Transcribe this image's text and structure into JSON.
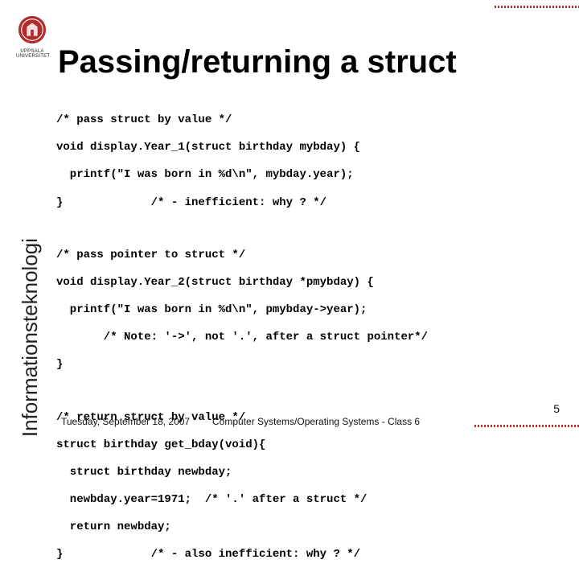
{
  "logo_text": "UPPSALA UNIVERSITET",
  "title": "Passing/returning a struct",
  "sidelabel": "Informationsteknologi",
  "code": {
    "block1": [
      "/* pass struct by value */",
      "void display.Year_1(struct birthday mybday) {",
      "  printf(\"I was born in %d\\n\", mybday.year);",
      "}             /* - inefficient: why ? */"
    ],
    "block2": [
      "/* pass pointer to struct */",
      "void display.Year_2(struct birthday *pmybday) {",
      "  printf(\"I was born in %d\\n\", pmybday->year);",
      "       /* Note: '->', not '.', after a struct pointer*/",
      "}"
    ],
    "block3": [
      "/* return struct by value */",
      "struct birthday get_bday(void){",
      "  struct birthday newbday;",
      "  newbday.year=1971;  /* '.' after a struct */",
      "  return newbday;",
      "}             /* - also inefficient: why ? */"
    ]
  },
  "footer": {
    "date": "Tuesday, September 18, 2007",
    "center": "Computer Systems/Operating Systems - Class 6",
    "page": "5"
  }
}
